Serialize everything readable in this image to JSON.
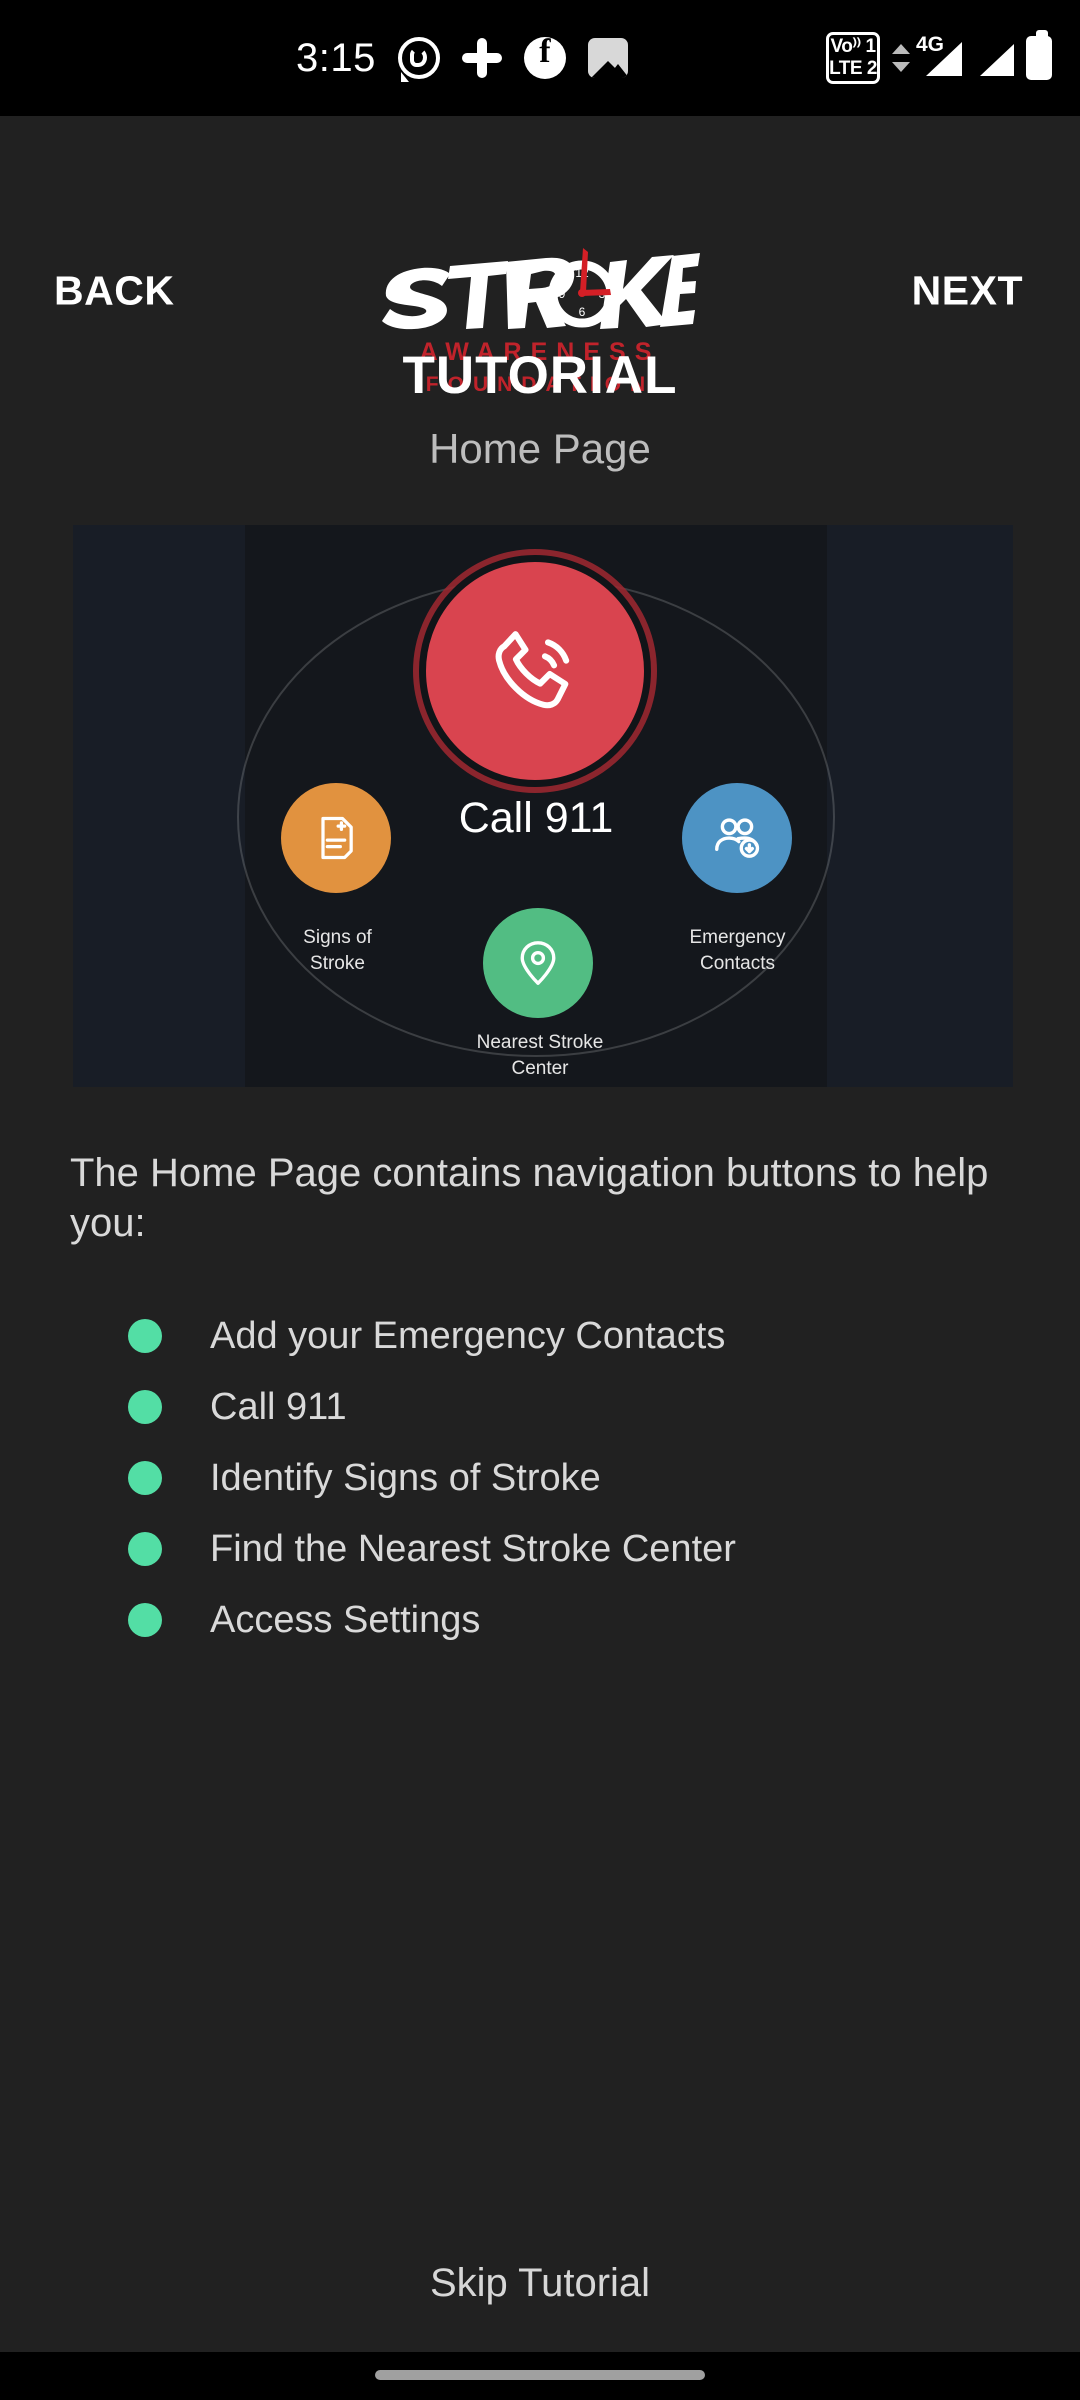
{
  "status_bar": {
    "time": "3:15",
    "left_icons": [
      "whatsapp-icon",
      "slack-icon",
      "facebook-icon",
      "photos-icon"
    ],
    "volte_line1": "Vo⁾⁾ 1",
    "volte_line2": "LTE 2",
    "network_type": "4G",
    "right_icons": [
      "volte-icon",
      "data-transfer-icon",
      "signal-4g-icon",
      "signal-icon",
      "battery-icon"
    ]
  },
  "header": {
    "back_label": "BACK",
    "next_label": "NEXT",
    "logo_word": "STROKE",
    "logo_sub1": "AWARENESS",
    "logo_sub2": "FOUNDATION",
    "clock_numerals": [
      "12",
      "3",
      "6",
      "9"
    ]
  },
  "page": {
    "title": "TUTORIAL",
    "subtitle": "Home Page",
    "intro": "The Home Page contains navigation buttons to help you:",
    "skip_label": "Skip Tutorial"
  },
  "preview": {
    "call_label": "Call 911",
    "signs_label": "Signs of\nStroke",
    "signs_line1": "Signs of",
    "signs_line2": "Stroke",
    "contacts_line1": "Emergency",
    "contacts_line2": "Contacts",
    "center_line1": "Nearest Stroke",
    "center_line2": "Center",
    "icons": [
      "phone-call-icon",
      "medical-document-icon",
      "add-contacts-icon",
      "map-pin-icon"
    ]
  },
  "bullets": [
    {
      "label": "Add your Emergency Contacts"
    },
    {
      "label": "Call 911"
    },
    {
      "label": "Identify Signs of Stroke"
    },
    {
      "label": "Find the Nearest Stroke Center"
    },
    {
      "label": "Access Settings"
    }
  ],
  "colors": {
    "background": "#212121",
    "accent_red": "#c0232b",
    "bullet_green": "#53dea5",
    "call_red": "#d9444f",
    "signs_orange": "#e1923f",
    "contacts_blue": "#4d93c4",
    "center_green": "#52bd83"
  }
}
